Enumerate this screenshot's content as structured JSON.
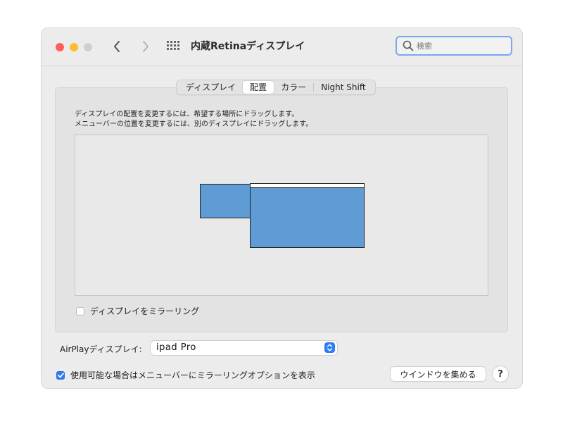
{
  "window": {
    "title": "内蔵Retinaディスプレイ",
    "search_placeholder": "検索"
  },
  "icons": {
    "back": "chevron-left-icon",
    "forward": "chevron-right-icon",
    "all_prefs": "grid-icon",
    "search": "magnifier-icon",
    "stepper": "up-down-chevron-icon",
    "check": "checkmark-icon"
  },
  "tabs": [
    {
      "label": "ディスプレイ",
      "active": false
    },
    {
      "label": "配置",
      "active": true
    },
    {
      "label": "カラー",
      "active": false
    },
    {
      "label": "Night Shift",
      "active": false
    }
  ],
  "arrangement": {
    "instruction_1": "ディスプレイの配置を変更するには、希望する場所にドラッグします。",
    "instruction_2": "メニューバーの位置を変更するには、別のディスプレイにドラッグします。",
    "mirror_label": "ディスプレイをミラーリング",
    "mirror_checked": false
  },
  "airplay": {
    "label": "AirPlayディスプレイ:",
    "selected": "ipad Pro"
  },
  "menu_option": {
    "label": "使用可能な場合はメニューバーにミラーリングオプションを表示",
    "checked": true
  },
  "buttons": {
    "gather_windows": "ウインドウを集める",
    "help": "?"
  },
  "colors": {
    "accent": "#2f7cf6",
    "display_fill": "#5f9bd5",
    "close": "#ff5f57",
    "minimize": "#febc2e",
    "zoom_disabled": "#cfcfcf",
    "search_focus": "#7aa7ee"
  }
}
